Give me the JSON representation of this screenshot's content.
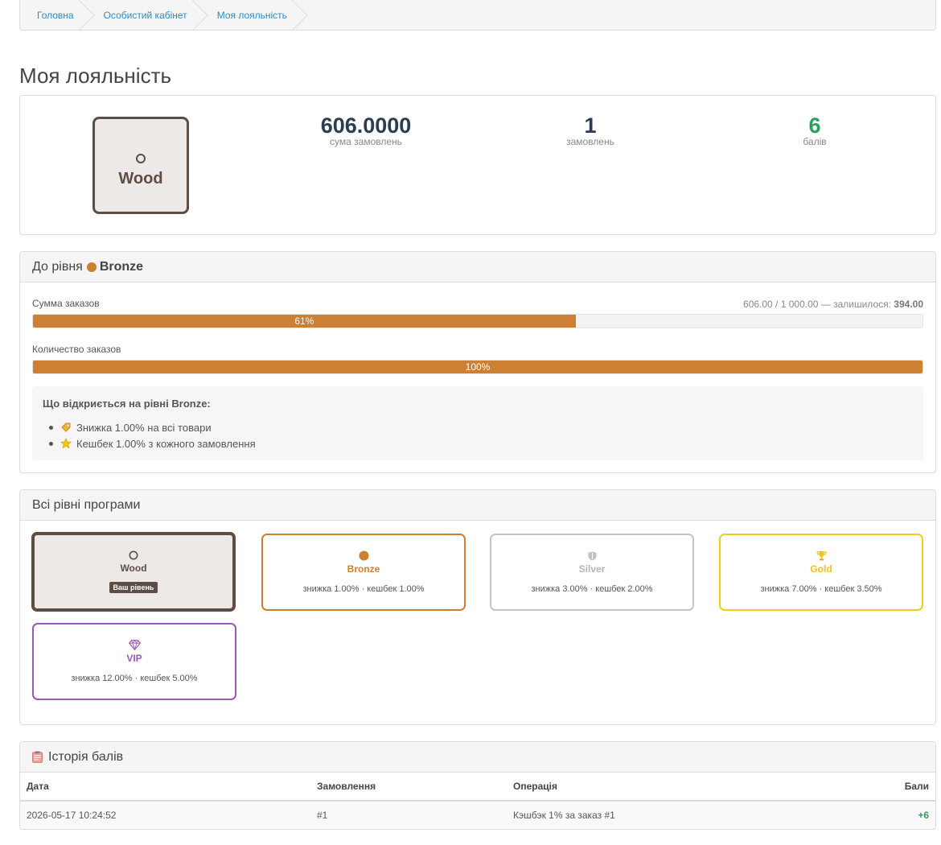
{
  "breadcrumb": [
    "Головна",
    "Особистий кабінет",
    "Моя лояльність"
  ],
  "page_title": "Моя лояльність",
  "summary": {
    "current_level": "Wood",
    "order_sum": "606.0000",
    "order_sum_label": "сума замовлень",
    "orders": "1",
    "orders_label": "замовлень",
    "points": "6",
    "points_label": "балів"
  },
  "next_level": {
    "heading_prefix": "До рівня",
    "name": "Bronze",
    "sum_label": "Сумма заказов",
    "sum_progress_text": "606.00 / 1 000.00 — залишилося:",
    "sum_remaining": "394.00",
    "sum_percent": 61,
    "sum_percent_label": "61%",
    "count_label": "Количество заказов",
    "count_percent": 100,
    "count_percent_label": "100%",
    "unlock_title": "Що відкриється на рівні Bronze:",
    "unlock_items": [
      "Знижка 1.00% на всі товари",
      "Кешбек 1.00% з кожного замовлення"
    ]
  },
  "levels": {
    "heading": "Всі рівні програми",
    "current_badge": "Ваш рівень",
    "items": [
      {
        "name": "Wood",
        "desc": "",
        "color": "#5e4d43",
        "icon": "circle-outline-icon"
      },
      {
        "name": "Bronze",
        "desc": "знижка 1.00% · кешбек 1.00%",
        "color": "#cd7f32",
        "icon": "circle-icon"
      },
      {
        "name": "Silver",
        "desc": "знижка 3.00% · кешбек 2.00%",
        "color": "#b8b8b8",
        "icon": "shield-icon"
      },
      {
        "name": "Gold",
        "desc": "знижка 7.00% · кешбек 3.50%",
        "color": "#f0cc1c",
        "icon": "trophy-icon"
      },
      {
        "name": "VIP",
        "desc": "знижка 12.00% · кешбек 5.00%",
        "color": "#9b59b6",
        "icon": "diamond-icon"
      }
    ]
  },
  "history": {
    "heading": "Історія балів",
    "columns": [
      "Дата",
      "Замовлення",
      "Операція",
      "Бали"
    ],
    "rows": [
      {
        "date": "2026-05-17 10:24:52",
        "order": "#1",
        "operation": "Кэшбэк 1% за заказ #1",
        "points": "+6"
      }
    ]
  }
}
